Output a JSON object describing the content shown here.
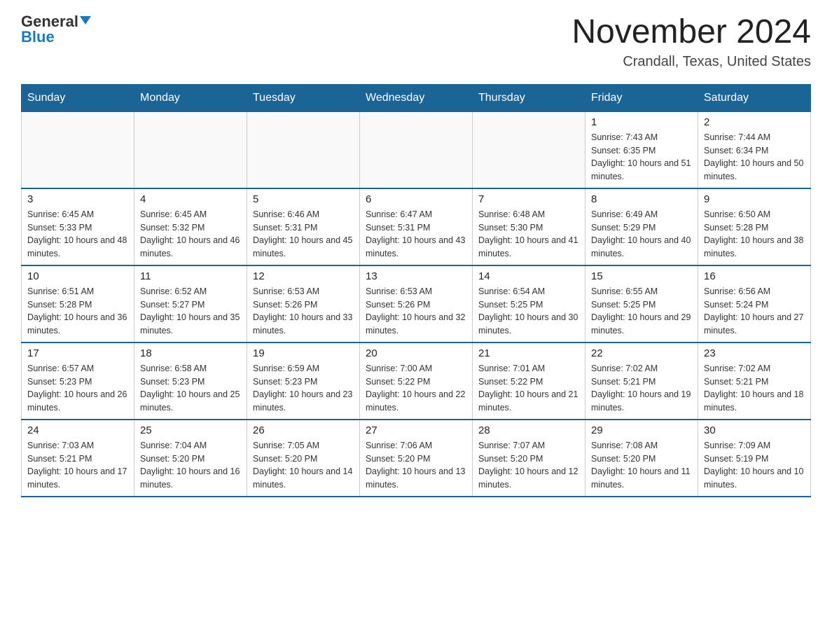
{
  "logo": {
    "general": "General",
    "blue": "Blue"
  },
  "title": "November 2024",
  "subtitle": "Crandall, Texas, United States",
  "weekdays": [
    "Sunday",
    "Monday",
    "Tuesday",
    "Wednesday",
    "Thursday",
    "Friday",
    "Saturday"
  ],
  "weeks": [
    [
      {
        "day": "",
        "sunrise": "",
        "sunset": "",
        "daylight": ""
      },
      {
        "day": "",
        "sunrise": "",
        "sunset": "",
        "daylight": ""
      },
      {
        "day": "",
        "sunrise": "",
        "sunset": "",
        "daylight": ""
      },
      {
        "day": "",
        "sunrise": "",
        "sunset": "",
        "daylight": ""
      },
      {
        "day": "",
        "sunrise": "",
        "sunset": "",
        "daylight": ""
      },
      {
        "day": "1",
        "sunrise": "Sunrise: 7:43 AM",
        "sunset": "Sunset: 6:35 PM",
        "daylight": "Daylight: 10 hours and 51 minutes."
      },
      {
        "day": "2",
        "sunrise": "Sunrise: 7:44 AM",
        "sunset": "Sunset: 6:34 PM",
        "daylight": "Daylight: 10 hours and 50 minutes."
      }
    ],
    [
      {
        "day": "3",
        "sunrise": "Sunrise: 6:45 AM",
        "sunset": "Sunset: 5:33 PM",
        "daylight": "Daylight: 10 hours and 48 minutes."
      },
      {
        "day": "4",
        "sunrise": "Sunrise: 6:45 AM",
        "sunset": "Sunset: 5:32 PM",
        "daylight": "Daylight: 10 hours and 46 minutes."
      },
      {
        "day": "5",
        "sunrise": "Sunrise: 6:46 AM",
        "sunset": "Sunset: 5:31 PM",
        "daylight": "Daylight: 10 hours and 45 minutes."
      },
      {
        "day": "6",
        "sunrise": "Sunrise: 6:47 AM",
        "sunset": "Sunset: 5:31 PM",
        "daylight": "Daylight: 10 hours and 43 minutes."
      },
      {
        "day": "7",
        "sunrise": "Sunrise: 6:48 AM",
        "sunset": "Sunset: 5:30 PM",
        "daylight": "Daylight: 10 hours and 41 minutes."
      },
      {
        "day": "8",
        "sunrise": "Sunrise: 6:49 AM",
        "sunset": "Sunset: 5:29 PM",
        "daylight": "Daylight: 10 hours and 40 minutes."
      },
      {
        "day": "9",
        "sunrise": "Sunrise: 6:50 AM",
        "sunset": "Sunset: 5:28 PM",
        "daylight": "Daylight: 10 hours and 38 minutes."
      }
    ],
    [
      {
        "day": "10",
        "sunrise": "Sunrise: 6:51 AM",
        "sunset": "Sunset: 5:28 PM",
        "daylight": "Daylight: 10 hours and 36 minutes."
      },
      {
        "day": "11",
        "sunrise": "Sunrise: 6:52 AM",
        "sunset": "Sunset: 5:27 PM",
        "daylight": "Daylight: 10 hours and 35 minutes."
      },
      {
        "day": "12",
        "sunrise": "Sunrise: 6:53 AM",
        "sunset": "Sunset: 5:26 PM",
        "daylight": "Daylight: 10 hours and 33 minutes."
      },
      {
        "day": "13",
        "sunrise": "Sunrise: 6:53 AM",
        "sunset": "Sunset: 5:26 PM",
        "daylight": "Daylight: 10 hours and 32 minutes."
      },
      {
        "day": "14",
        "sunrise": "Sunrise: 6:54 AM",
        "sunset": "Sunset: 5:25 PM",
        "daylight": "Daylight: 10 hours and 30 minutes."
      },
      {
        "day": "15",
        "sunrise": "Sunrise: 6:55 AM",
        "sunset": "Sunset: 5:25 PM",
        "daylight": "Daylight: 10 hours and 29 minutes."
      },
      {
        "day": "16",
        "sunrise": "Sunrise: 6:56 AM",
        "sunset": "Sunset: 5:24 PM",
        "daylight": "Daylight: 10 hours and 27 minutes."
      }
    ],
    [
      {
        "day": "17",
        "sunrise": "Sunrise: 6:57 AM",
        "sunset": "Sunset: 5:23 PM",
        "daylight": "Daylight: 10 hours and 26 minutes."
      },
      {
        "day": "18",
        "sunrise": "Sunrise: 6:58 AM",
        "sunset": "Sunset: 5:23 PM",
        "daylight": "Daylight: 10 hours and 25 minutes."
      },
      {
        "day": "19",
        "sunrise": "Sunrise: 6:59 AM",
        "sunset": "Sunset: 5:23 PM",
        "daylight": "Daylight: 10 hours and 23 minutes."
      },
      {
        "day": "20",
        "sunrise": "Sunrise: 7:00 AM",
        "sunset": "Sunset: 5:22 PM",
        "daylight": "Daylight: 10 hours and 22 minutes."
      },
      {
        "day": "21",
        "sunrise": "Sunrise: 7:01 AM",
        "sunset": "Sunset: 5:22 PM",
        "daylight": "Daylight: 10 hours and 21 minutes."
      },
      {
        "day": "22",
        "sunrise": "Sunrise: 7:02 AM",
        "sunset": "Sunset: 5:21 PM",
        "daylight": "Daylight: 10 hours and 19 minutes."
      },
      {
        "day": "23",
        "sunrise": "Sunrise: 7:02 AM",
        "sunset": "Sunset: 5:21 PM",
        "daylight": "Daylight: 10 hours and 18 minutes."
      }
    ],
    [
      {
        "day": "24",
        "sunrise": "Sunrise: 7:03 AM",
        "sunset": "Sunset: 5:21 PM",
        "daylight": "Daylight: 10 hours and 17 minutes."
      },
      {
        "day": "25",
        "sunrise": "Sunrise: 7:04 AM",
        "sunset": "Sunset: 5:20 PM",
        "daylight": "Daylight: 10 hours and 16 minutes."
      },
      {
        "day": "26",
        "sunrise": "Sunrise: 7:05 AM",
        "sunset": "Sunset: 5:20 PM",
        "daylight": "Daylight: 10 hours and 14 minutes."
      },
      {
        "day": "27",
        "sunrise": "Sunrise: 7:06 AM",
        "sunset": "Sunset: 5:20 PM",
        "daylight": "Daylight: 10 hours and 13 minutes."
      },
      {
        "day": "28",
        "sunrise": "Sunrise: 7:07 AM",
        "sunset": "Sunset: 5:20 PM",
        "daylight": "Daylight: 10 hours and 12 minutes."
      },
      {
        "day": "29",
        "sunrise": "Sunrise: 7:08 AM",
        "sunset": "Sunset: 5:20 PM",
        "daylight": "Daylight: 10 hours and 11 minutes."
      },
      {
        "day": "30",
        "sunrise": "Sunrise: 7:09 AM",
        "sunset": "Sunset: 5:19 PM",
        "daylight": "Daylight: 10 hours and 10 minutes."
      }
    ]
  ]
}
